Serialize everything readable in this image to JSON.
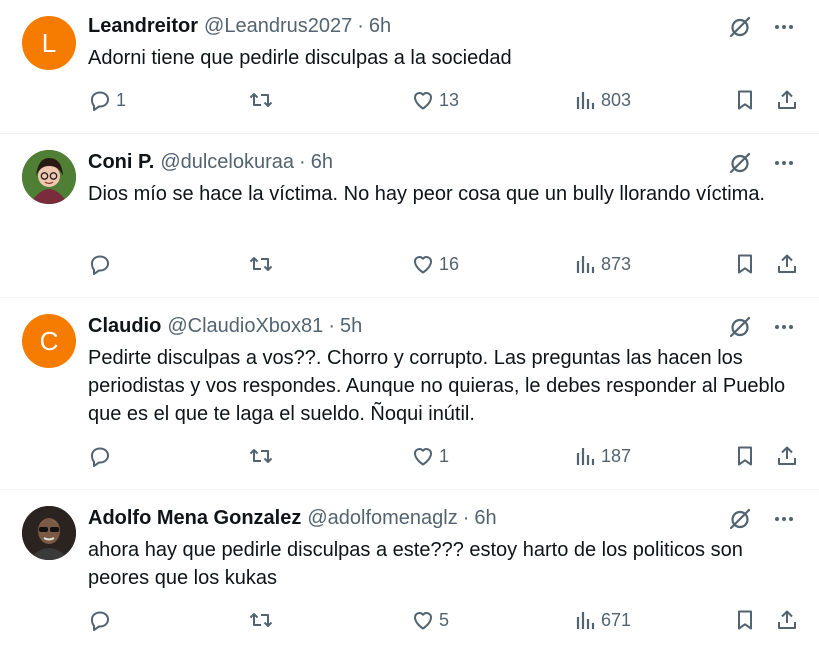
{
  "tweets": [
    {
      "avatar_letter": "L",
      "name": "Leandreitor",
      "handle": "@Leandrus2027",
      "time": "6h",
      "text": "Adorni tiene que pedirle disculpas a la sociedad",
      "replies": "1",
      "retweets": "",
      "likes": "13",
      "views": "803"
    },
    {
      "avatar_letter": "",
      "name": "Coni P.",
      "handle": "@dulcelokuraa",
      "time": "6h",
      "text": "Dios mío se hace la víctima.  No hay peor cosa que un bully llorando víctima.",
      "replies": "",
      "retweets": "",
      "likes": "16",
      "views": "873"
    },
    {
      "avatar_letter": "C",
      "name": "Claudio",
      "handle": "@ClaudioXbox81",
      "time": "5h",
      "text": "Pedirte disculpas a vos??. Chorro y corrupto. Las preguntas las hacen los periodistas y vos respondes. Aunque no quieras, le debes responder al Pueblo que es el que te laga el sueldo. Ñoqui inútil.",
      "replies": "",
      "retweets": "",
      "likes": "1",
      "views": "187"
    },
    {
      "avatar_letter": "",
      "name": "Adolfo Mena Gonzalez",
      "handle": "@adolfomenaglz",
      "time": "6h",
      "text": "ahora hay que pedirle disculpas a este??? estoy harto de los politicos son peores que los kukas",
      "replies": "",
      "retweets": "",
      "likes": "5",
      "views": "671"
    }
  ],
  "separator": "·",
  "icons": {
    "grok": "grok-icon",
    "more": "more-icon",
    "reply": "reply-icon",
    "retweet": "retweet-icon",
    "like": "like-icon",
    "views": "views-icon",
    "bookmark": "bookmark-icon",
    "share": "share-icon"
  },
  "colors": {
    "text": "#0f1419",
    "secondary": "#536471",
    "divider": "#eff3f4",
    "avatar_orange": "#f57c00"
  }
}
